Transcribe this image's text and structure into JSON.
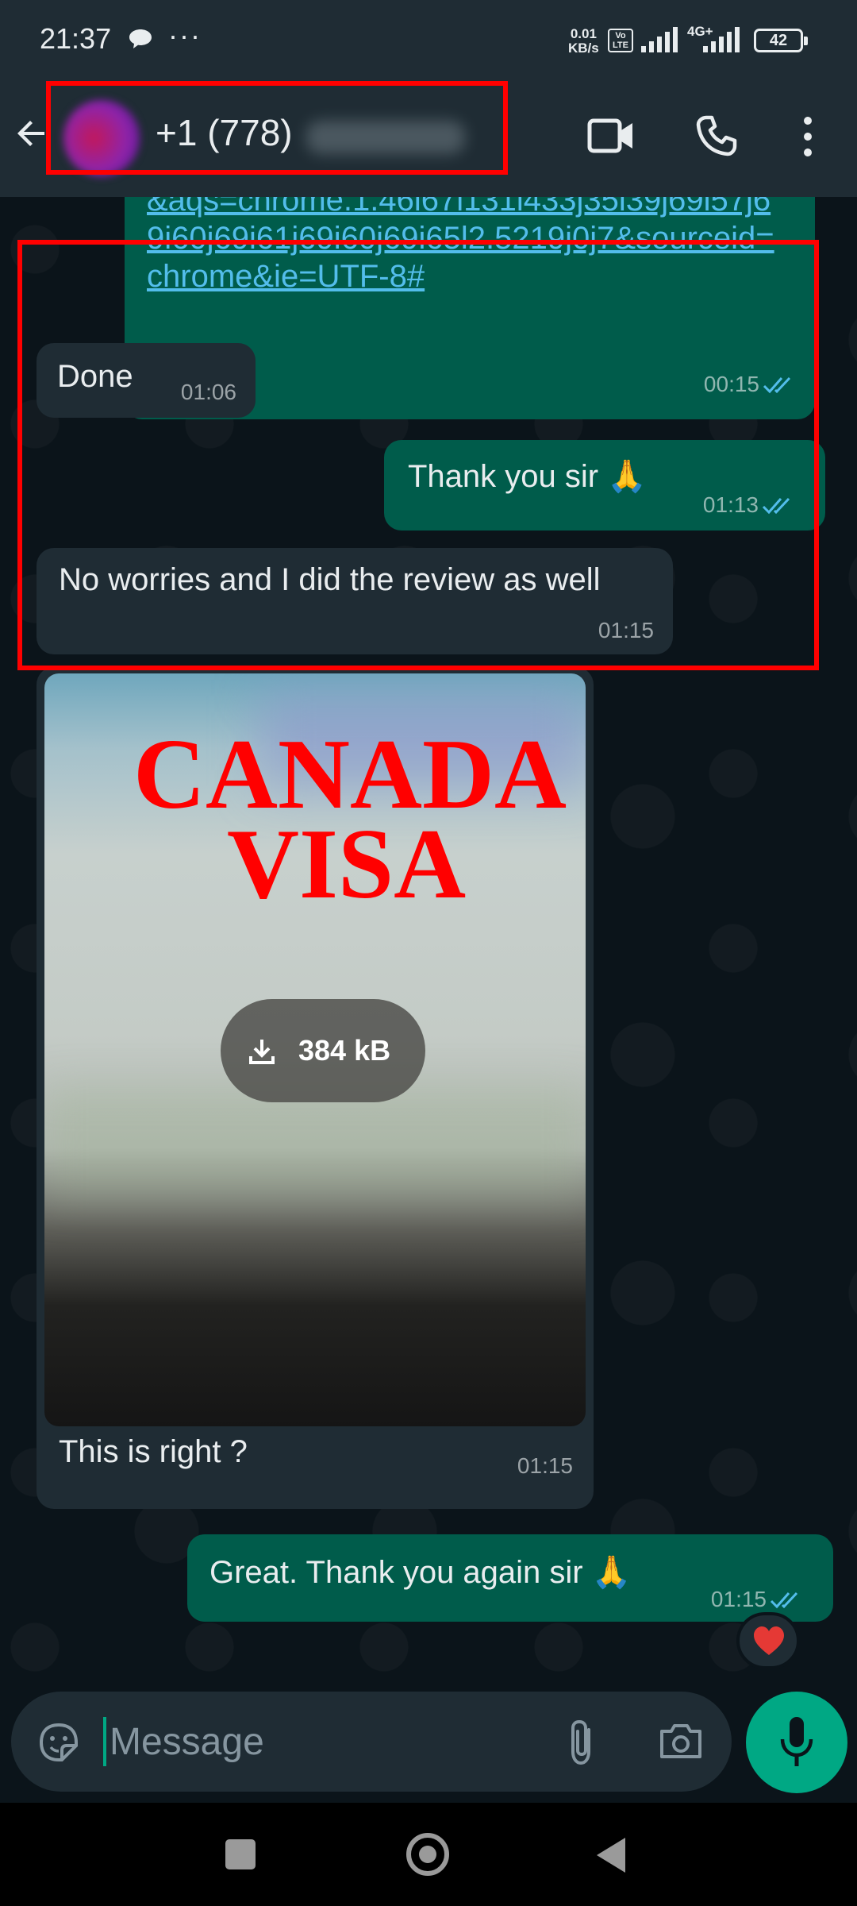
{
  "status_bar": {
    "time": "21:37",
    "dots": "···",
    "speed_value": "0.01",
    "speed_unit": "KB/s",
    "volte_top": "Vo",
    "volte_bottom": "LTE",
    "network": "4G+",
    "battery": "42"
  },
  "header": {
    "contact_name": "+1 (778)",
    "icons": [
      "back-arrow-icon",
      "video-call-icon",
      "phone-call-icon",
      "more-options-icon"
    ]
  },
  "messages": {
    "link": {
      "text": "&aqs=chrome.1.46i67i131i433j35i39j69i57j69i60j69i61j69i60j69i65l2.5219j0j7&sourceid=chrome&ie=UTF-8#",
      "time": "00:15",
      "status": "read"
    },
    "done": {
      "text": "Done",
      "time": "01:06"
    },
    "thanks": {
      "text": "Thank you sir 🙏",
      "time": "01:13",
      "status": "read"
    },
    "noworries": {
      "text": "No worries and I did the review as well",
      "time": "01:15"
    },
    "media": {
      "overlay_line1": "CANADA",
      "overlay_line2": "VISA",
      "size": "384 kB",
      "caption": "This is right ?",
      "time": "01:15"
    },
    "great": {
      "text": "Great. Thank you again sir 🙏",
      "time": "01:15",
      "status": "read",
      "reaction": "❤️"
    }
  },
  "input": {
    "placeholder": "Message",
    "value": ""
  },
  "colors": {
    "background": "#0b141a",
    "incoming_bubble": "#1f2c34",
    "outgoing_bubble": "#005c4b",
    "accent": "#00a884",
    "link": "#53bdeb",
    "read_ticks": "#53bdeb",
    "highlight": "#ff0000"
  }
}
